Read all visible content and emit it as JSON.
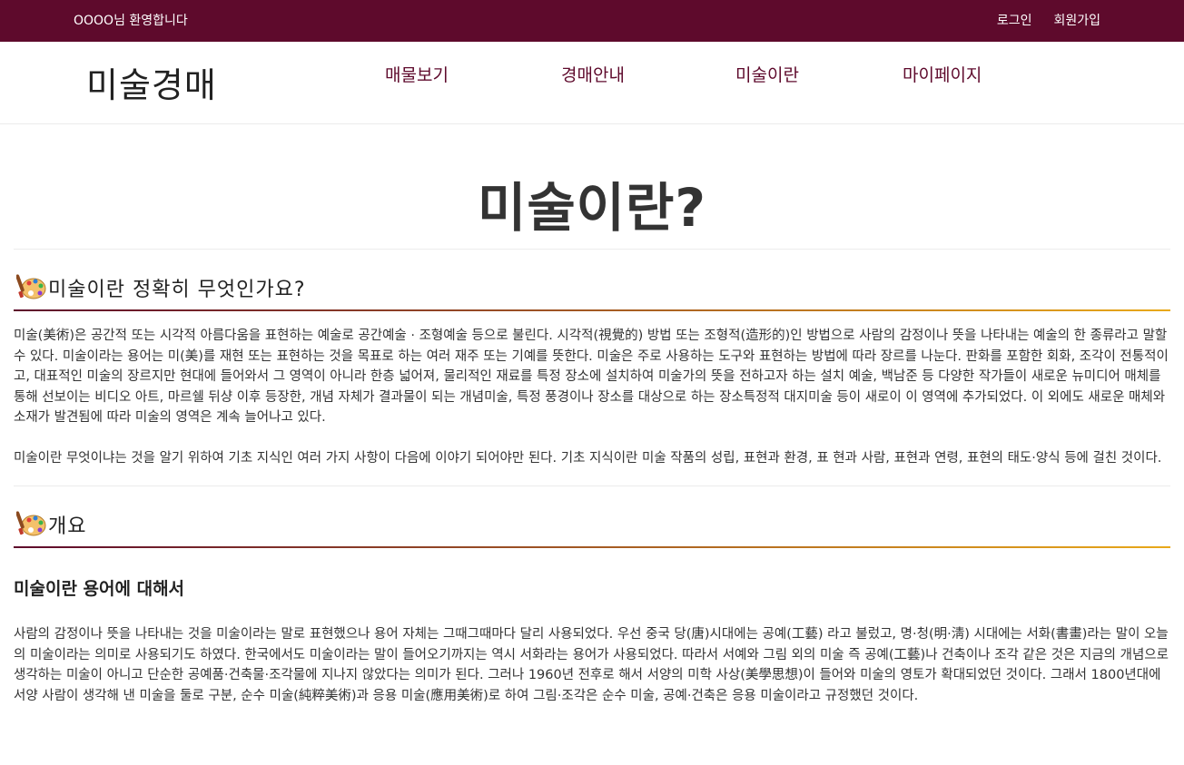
{
  "topbar": {
    "welcome": "OOOO님 환영합니다",
    "login": "로그인",
    "signup": "회원가입"
  },
  "nav": {
    "logo": "미술경매",
    "items": [
      "매물보기",
      "경매안내",
      "미술이란",
      "마이페이지"
    ]
  },
  "page": {
    "title": "미술이란?"
  },
  "sections": {
    "what": {
      "heading": "미술이란 정확히 무엇인가요?",
      "icon": "palette-icon",
      "p1": " 미술(美術)은 공간적 또는 시각적 아름다움을 표현하는 예술로 공간예술 · 조형예술 등으로 불린다. 시각적(視覺的) 방법 또는 조형적(造形的)인 방법으로 사람의 감정이나 뜻을 나타내는 예술의 한 종류라고 말할 수 있다. 미술이라는 용어는 미(美)를 재현 또는 표현하는 것을 목표로 하는 여러 재주 또는 기예를 뜻한다. 미술은 주로 사용하는 도구와 표현하는 방법에 따라 장르를 나눈다. 판화를 포함한 회화, 조각이 전통적이고, 대표적인 미술의 장르지만 현대에 들어와서 그 영역이 아니라 한층 넓어져, 물리적인 재료를 특정 장소에 설치하여 미술가의 뜻을 전하고자 하는 설치 예술, 백남준 등 다양한 작가들이 새로운 뉴미디어 매체를 통해 선보이는 비디오 아트, 마르쉘 뒤샹 이후 등장한, 개념 자체가 결과물이 되는 개념미술, 특정 풍경이나 장소를 대상으로 하는 장소특정적 대지미술 등이 새로이 이 영역에 추가되었다. 이 외에도 새로운 매체와 소재가 발견됨에 따라 미술의 영역은 계속 늘어나고 있다.",
      "p2": "미술이란 무엇이냐는 것을 알기 위하여 기초 지식인 여러 가지 사항이 다음에 이야기 되어야만 된다. 기초 지식이란 미술 작품의 성립, 표현과 환경, 표 현과 사람, 표현과 연령, 표현의 태도·양식 등에 걸친 것이다."
    },
    "overview": {
      "heading": "개요",
      "icon": "palette-icon",
      "subheading": "미술이란 용어에 대해서",
      "p1": " 사람의 감정이나 뜻을 나타내는 것을 미술이라는 말로 표현했으나 용어 자체는 그때그때마다 달리 사용되었다. 우선 중국 당(唐)시대에는 공예(工藝) 라고 불렀고, 명·청(明·淸) 시대에는 서화(書畫)라는 말이 오늘의 미술이라는 의미로 사용되기도 하였다. 한국에서도 미술이라는 말이 들어오기까지는 역시 서화라는 용어가 사용되었다. 따라서 서예와 그림 외의 미술 즉 공예(工藝)나 건축이나 조각 같은 것은 지금의 개념으로 생각하는 미술이 아니고 단순한 공예품·건축물·조각물에 지나지 않았다는 의미가 된다. 그러나 1960년 전후로 해서 서양의 미학 사상(美學思想)이 들어와 미술의 영토가 확대되었던 것이다. 그래서 1800년대에 서양 사람이 생각해 낸 미술을 둘로 구분, 순수 미술(純粹美術)과 응용 미술(應用美術)로 하여 그림·조각은 순수 미술, 공예·건축은 응용 미술이라고 규정했던 것이다."
    }
  },
  "colors": {
    "brand": "#5e0a2c",
    "accent": "#e9a91a"
  }
}
